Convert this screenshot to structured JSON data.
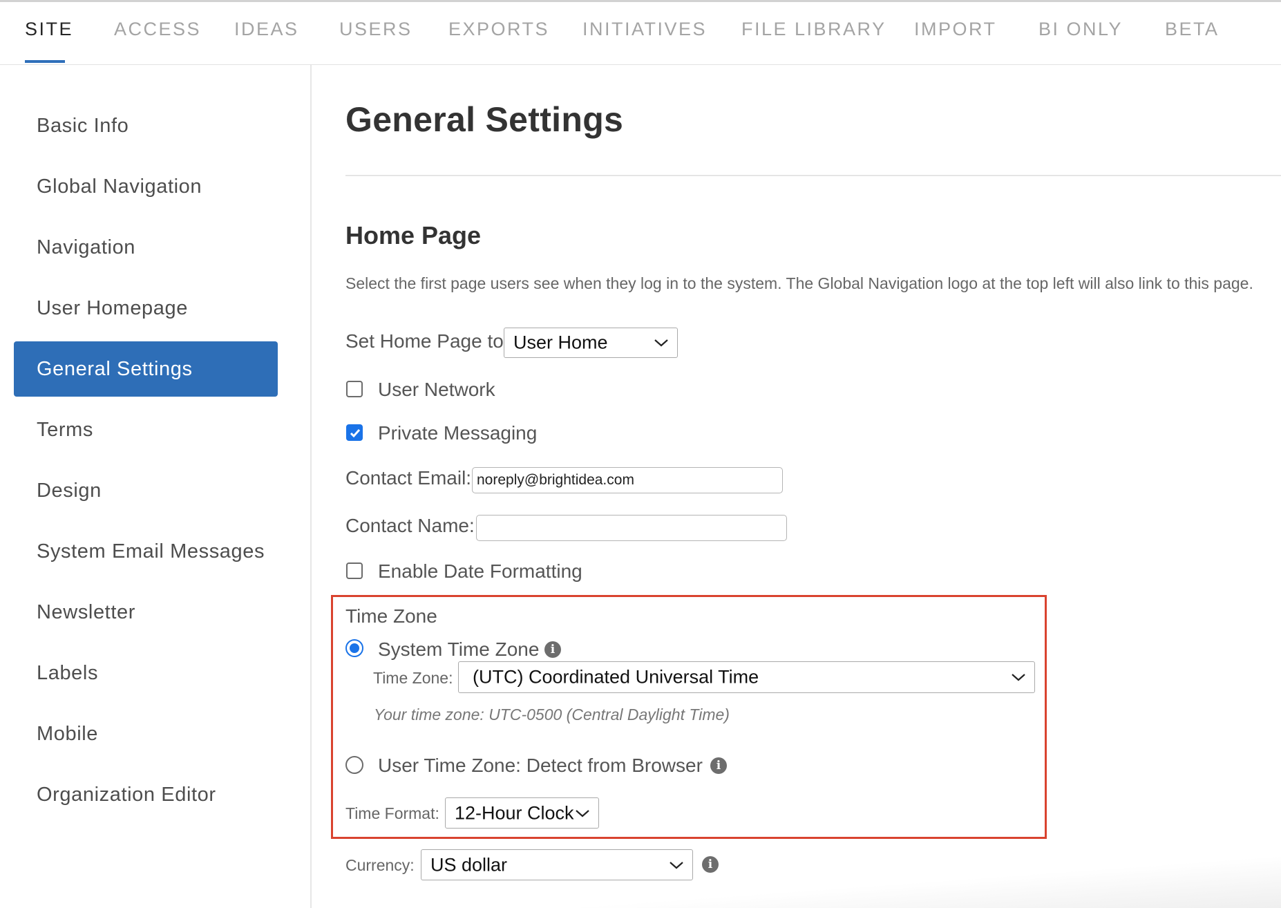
{
  "top_nav": {
    "tabs": [
      {
        "label": "SITE",
        "active": true
      },
      {
        "label": "ACCESS",
        "active": false
      },
      {
        "label": "IDEAS",
        "active": false
      },
      {
        "label": "USERS",
        "active": false
      },
      {
        "label": "EXPORTS",
        "active": false
      },
      {
        "label": "INITIATIVES",
        "active": false
      },
      {
        "label": "FILE LIBRARY",
        "active": false
      },
      {
        "label": "IMPORT",
        "active": false
      },
      {
        "label": "BI ONLY",
        "active": false
      },
      {
        "label": "BETA",
        "active": false
      }
    ]
  },
  "sidebar": {
    "items": [
      {
        "label": "Basic Info",
        "active": false
      },
      {
        "label": "Global Navigation",
        "active": false
      },
      {
        "label": "Navigation",
        "active": false
      },
      {
        "label": "User Homepage",
        "active": false
      },
      {
        "label": "General Settings",
        "active": true
      },
      {
        "label": "Terms",
        "active": false
      },
      {
        "label": "Design",
        "active": false
      },
      {
        "label": "System Email Messages",
        "active": false
      },
      {
        "label": "Newsletter",
        "active": false
      },
      {
        "label": "Labels",
        "active": false
      },
      {
        "label": "Mobile",
        "active": false
      },
      {
        "label": "Organization Editor",
        "active": false
      }
    ]
  },
  "main": {
    "page_title": "General Settings",
    "home_page": {
      "section_title": "Home Page",
      "description": "Select the first page users see when they log in to the system. The Global Navigation logo at the top left will also link to this page.",
      "set_home_label": "Set Home Page to:",
      "set_home_value": "User Home",
      "user_network_label": "User Network",
      "user_network_checked": false,
      "private_messaging_label": "Private Messaging",
      "private_messaging_checked": true,
      "contact_email_label": "Contact Email:",
      "contact_email_value": "noreply@brightidea.com",
      "contact_name_label": "Contact Name:",
      "contact_name_value": "",
      "date_formatting_label": "Enable Date Formatting",
      "date_formatting_checked": false
    },
    "time_zone": {
      "heading": "Time Zone",
      "system_tz_label": "System Time Zone",
      "system_tz_selected": true,
      "tz_select_label": "Time Zone:",
      "tz_select_value": "(UTC) Coordinated Universal Time",
      "your_tz_hint": "Your time zone: UTC-0500 (Central Daylight Time)",
      "user_tz_label": "User Time Zone: Detect from Browser",
      "user_tz_selected": false,
      "time_format_label": "Time Format:",
      "time_format_value": "12-Hour Clock"
    },
    "currency": {
      "label": "Currency:",
      "value": "US dollar"
    },
    "info_icon_glyph": "i"
  },
  "colors": {
    "accent": "#2e6eb7",
    "checkbox_blue": "#1a73e8",
    "highlight_red": "#d9432f"
  }
}
